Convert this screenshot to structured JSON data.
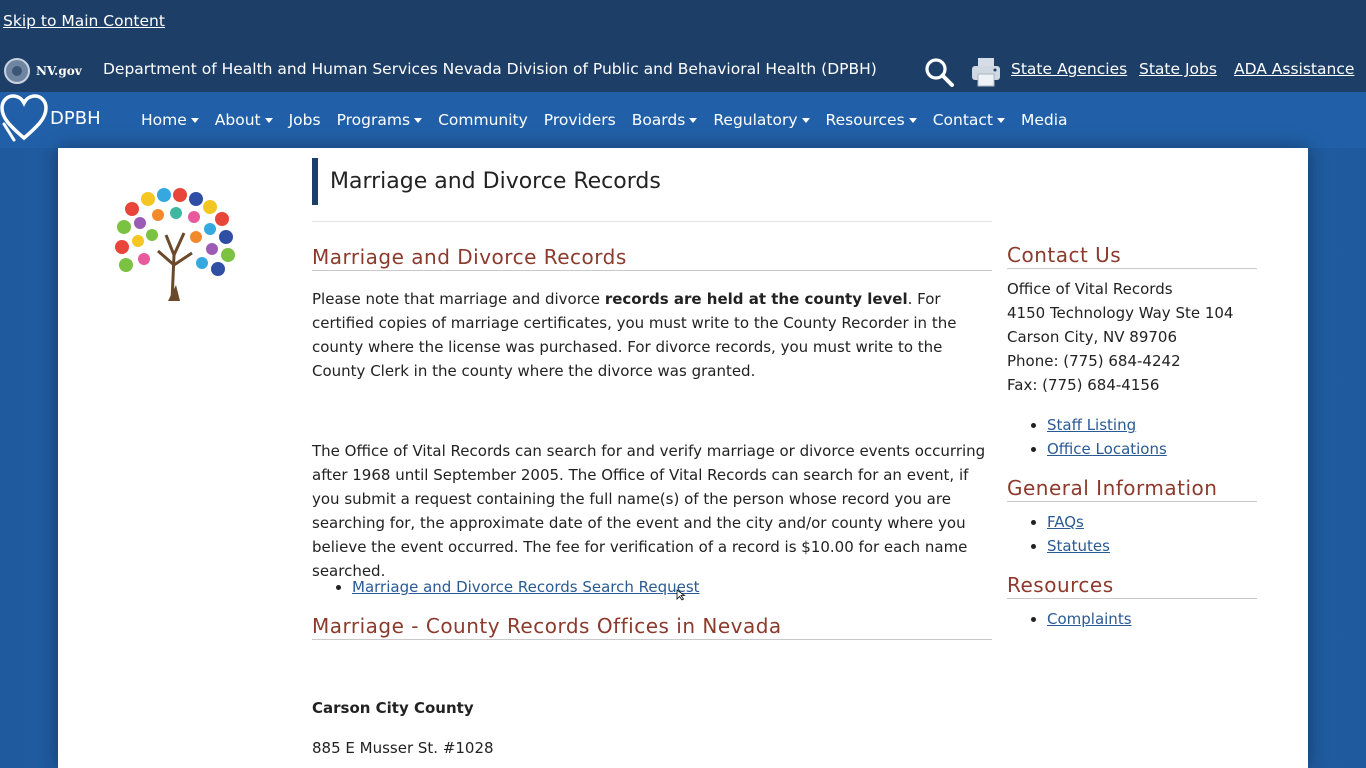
{
  "topbar": {
    "skip_link": "Skip to Main Content",
    "nvgov_label": "NV.gov",
    "department": "Department of Health and Human Services Nevada Division of Public and Behavioral Health (DPBH)",
    "search_icon": "search-icon",
    "print_icon": "printer-icon",
    "links": [
      "State Agencies",
      "State Jobs",
      "ADA Assistance"
    ]
  },
  "navbar": {
    "logo_text": "DPBH",
    "items": [
      {
        "label": "Home",
        "dropdown": true
      },
      {
        "label": "About",
        "dropdown": true
      },
      {
        "label": "Jobs",
        "dropdown": false
      },
      {
        "label": "Programs",
        "dropdown": true
      },
      {
        "label": "Community",
        "dropdown": false
      },
      {
        "label": "Providers",
        "dropdown": false
      },
      {
        "label": "Boards",
        "dropdown": true
      },
      {
        "label": "Regulatory",
        "dropdown": true
      },
      {
        "label": "Resources",
        "dropdown": true
      },
      {
        "label": "Contact",
        "dropdown": true
      },
      {
        "label": "Media",
        "dropdown": false
      }
    ]
  },
  "main": {
    "page_title": "Marriage and Divorce Records",
    "section1_heading": "Marriage and Divorce Records",
    "para1_before": "Please note that marriage and divorce ",
    "para1_bold": "records are held at the county level",
    "para1_after": ". For certified copies of marriage certificates, you must write to the County Recorder in the county where the license was purchased. For divorce records, you must write to the County Clerk in the county where the divorce was granted.",
    "para2": "The Office of Vital Records can search for and verify marriage or divorce events occurring after 1968 until September 2005.  The Office of Vital Records can search for an event, if you submit a request containing the full name(s) of the person whose record you are searching for, the approximate date of the event and the city and/or county where you believe the event occurred. The fee for verification of a record is $10.00 for each name searched.",
    "search_request_link": "Marriage and Divorce Records Search Request",
    "section2_heading": "Marriage - County Records Offices in Nevada",
    "county_name": "Carson City County",
    "county_address": "885 E Musser St. #1028"
  },
  "sidebar": {
    "contact_heading": "Contact Us",
    "contact_lines": [
      "Office of Vital Records",
      "4150 Technology Way Ste 104",
      "Carson City, NV 89706",
      "Phone: (775) 684-4242",
      "Fax: (775) 684-4156"
    ],
    "contact_links": [
      "Staff Listing",
      "Office Locations"
    ],
    "general_heading": "General Information",
    "general_links": [
      "FAQs",
      "Statutes"
    ],
    "resources_heading": "Resources",
    "resources_links": [
      "Complaints"
    ]
  },
  "colors": {
    "topbar": "#1d3e66",
    "navbar": "#2160a8",
    "heading": "#8b3a2c",
    "link": "#2a5a93"
  }
}
